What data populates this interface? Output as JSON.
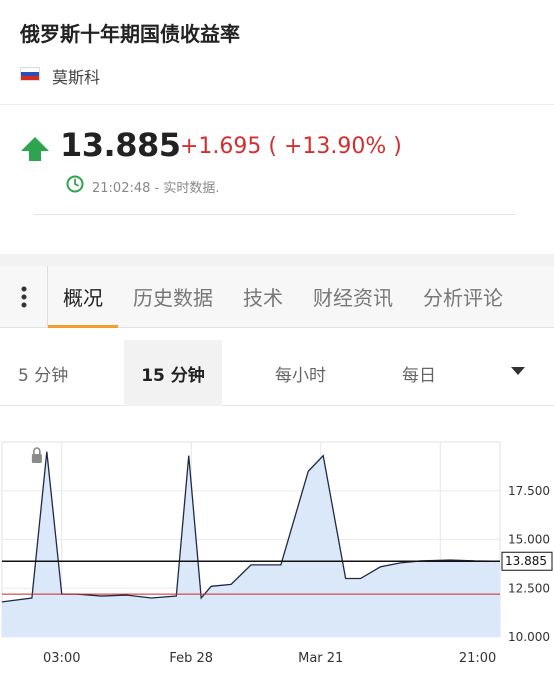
{
  "header": {
    "title": "俄罗斯十年期国债收益率",
    "location": "莫斯科"
  },
  "quote": {
    "price": "13.885",
    "change": "+1.695 ( +13.90% )",
    "time": "21:02:48 - 实时数据."
  },
  "tabs": [
    {
      "label": "概况"
    },
    {
      "label": "历史数据"
    },
    {
      "label": "技术"
    },
    {
      "label": "财经资讯"
    },
    {
      "label": "分析评论"
    }
  ],
  "intervals": [
    {
      "label": "5 分钟"
    },
    {
      "label": "15 分钟"
    },
    {
      "label": "每小时"
    },
    {
      "label": "每日"
    }
  ],
  "colors": {
    "up": "#2ea44f",
    "down": "#d32f2f",
    "tab_accent": "#f0a030",
    "chart_fill": "#dbe8fa",
    "chart_line": "#1f2a44"
  },
  "chart_data": {
    "type": "area",
    "x_tick_labels": [
      "03:00",
      "Feb 28",
      "Mar 21",
      "21:00"
    ],
    "y_tick_labels": [
      "17.500",
      "15.000",
      "12.500",
      "10.000"
    ],
    "ylim": [
      10,
      20
    ],
    "last_value_label": "13.885",
    "current_line": 13.885,
    "reference_line": 12.2,
    "points": [
      [
        0,
        11.8
      ],
      [
        0.06,
        12.0
      ],
      [
        0.09,
        19.5
      ],
      [
        0.12,
        12.2
      ],
      [
        0.15,
        12.2
      ],
      [
        0.2,
        12.1
      ],
      [
        0.25,
        12.15
      ],
      [
        0.3,
        12.0
      ],
      [
        0.35,
        12.1
      ],
      [
        0.375,
        19.3
      ],
      [
        0.4,
        12.0
      ],
      [
        0.42,
        12.6
      ],
      [
        0.46,
        12.7
      ],
      [
        0.5,
        13.7
      ],
      [
        0.56,
        13.7
      ],
      [
        0.615,
        18.5
      ],
      [
        0.645,
        19.3
      ],
      [
        0.69,
        13.0
      ],
      [
        0.72,
        13.0
      ],
      [
        0.76,
        13.6
      ],
      [
        0.8,
        13.8
      ],
      [
        0.84,
        13.9
      ],
      [
        0.9,
        13.95
      ],
      [
        0.95,
        13.9
      ],
      [
        1.0,
        13.885
      ]
    ],
    "grid": true
  }
}
